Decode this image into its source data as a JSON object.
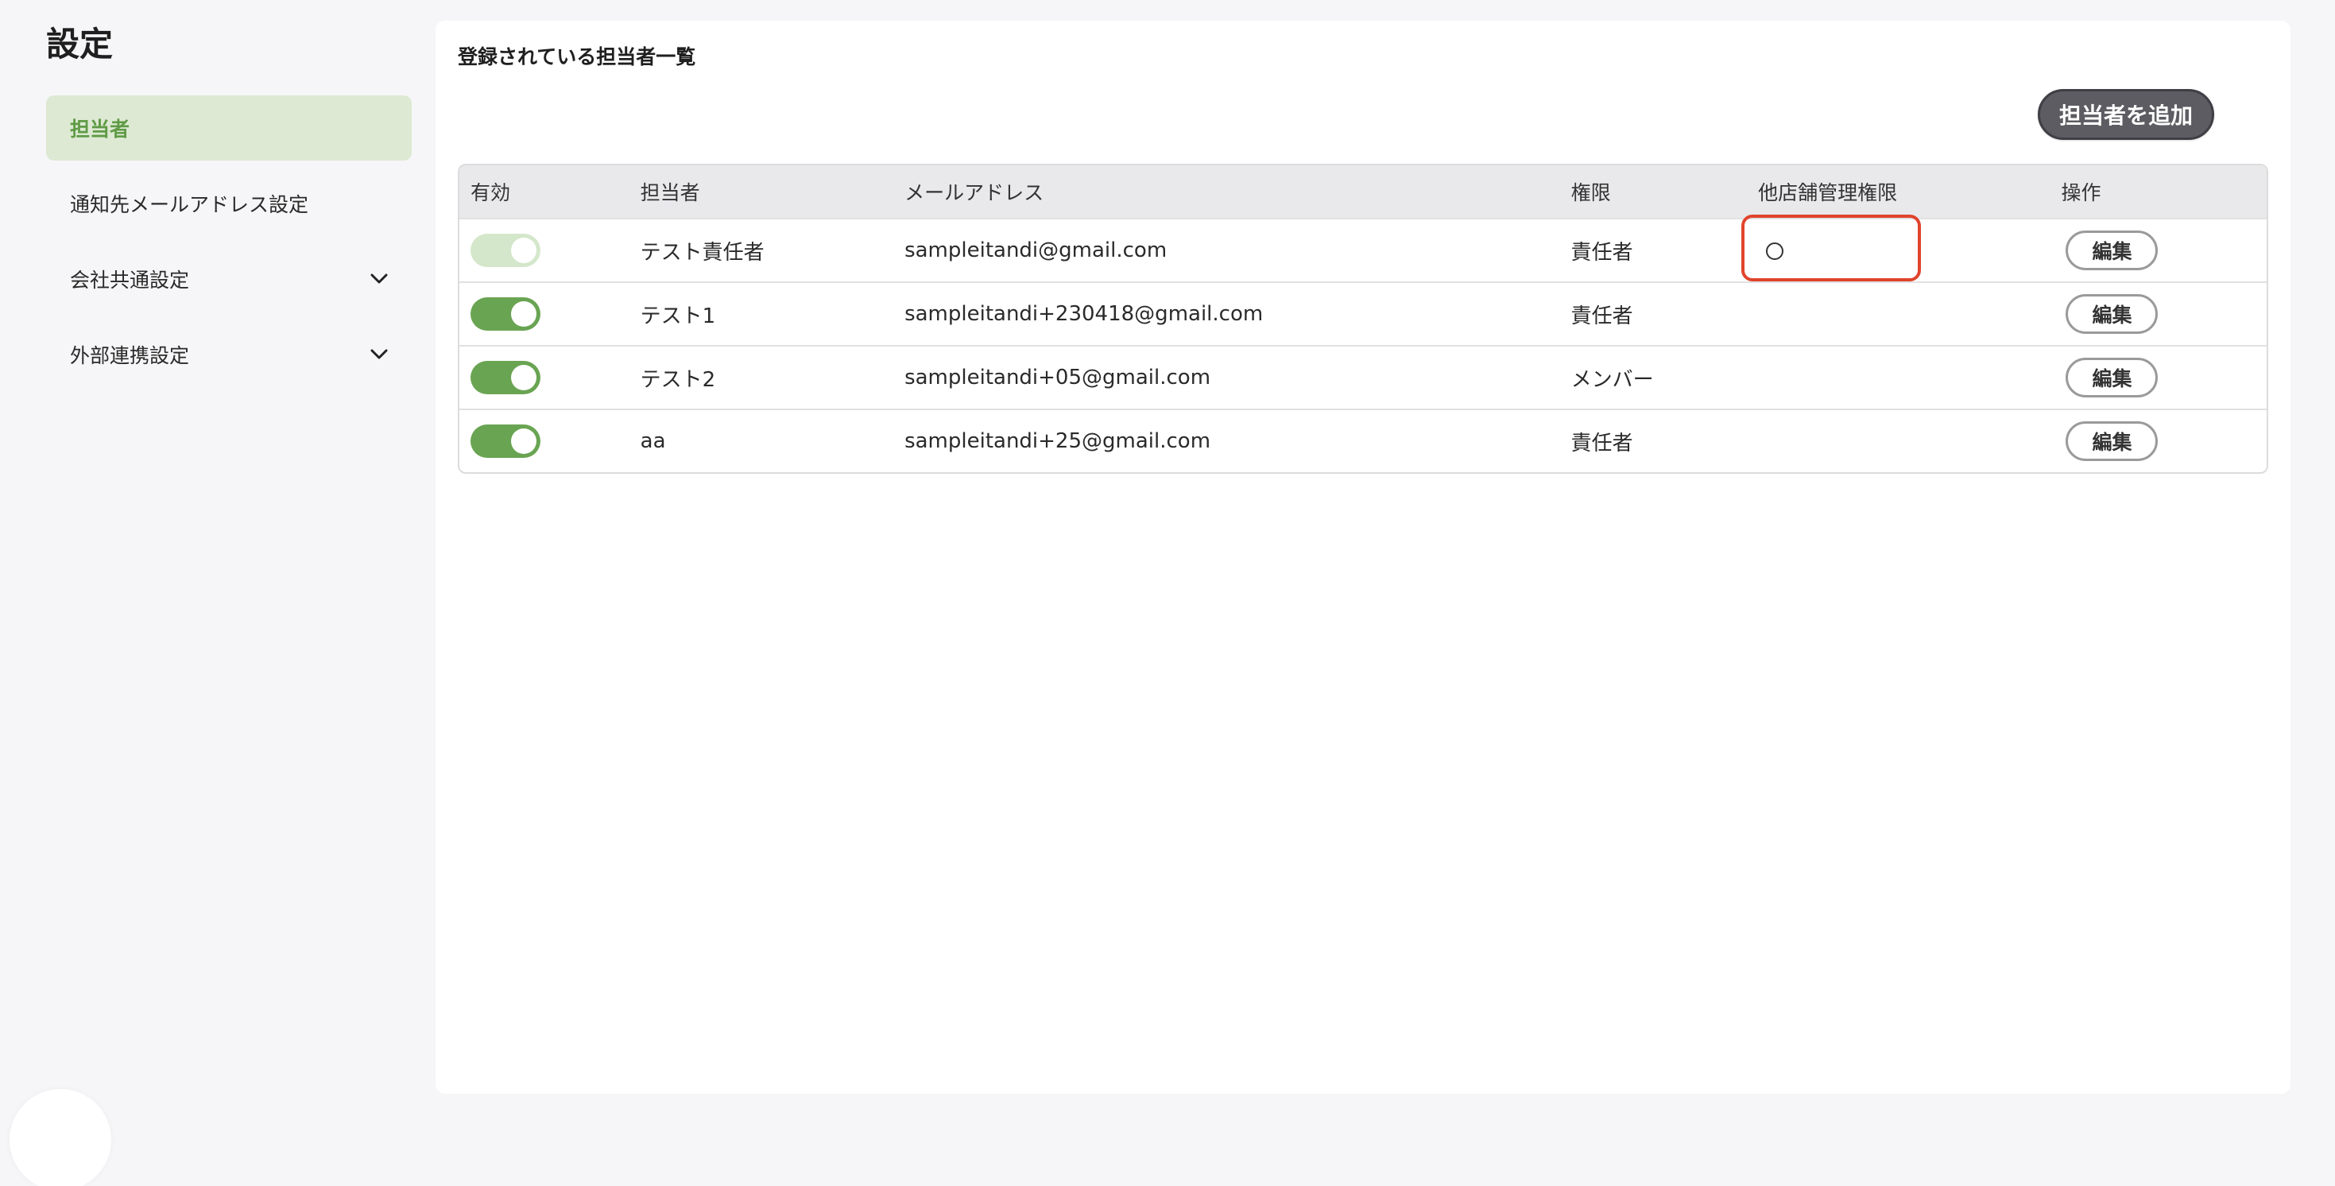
{
  "page": {
    "title": "設定"
  },
  "sidebar": {
    "items": [
      {
        "label": "担当者",
        "active": true
      },
      {
        "label": "通知先メールアドレス設定"
      },
      {
        "label": "会社共通設定",
        "has_chevron": true
      },
      {
        "label": "外部連携設定",
        "has_chevron": true
      }
    ]
  },
  "main": {
    "heading": "登録されている担当者一覧",
    "add_button": "担当者を追加",
    "table": {
      "headers": [
        "有効",
        "担当者",
        "メールアドレス",
        "権限",
        "他店舗管理権限",
        "操作"
      ],
      "rows": [
        {
          "active": true,
          "toggle_disabled": true,
          "name": "テスト責任者",
          "email": "sampleitandi@gmail.com",
          "role": "責任者",
          "other_store": "○",
          "action": "編集"
        },
        {
          "active": true,
          "toggle_disabled": false,
          "name": "テスト1",
          "email": "sampleitandi+230418@gmail.com",
          "role": "責任者",
          "other_store": "",
          "action": "編集"
        },
        {
          "active": true,
          "toggle_disabled": false,
          "name": "テスト2",
          "email": "sampleitandi+05@gmail.com",
          "role": "メンバー",
          "other_store": "",
          "action": "編集"
        },
        {
          "active": true,
          "toggle_disabled": false,
          "name": "aa",
          "email": "sampleitandi+25@gmail.com",
          "role": "責任者",
          "other_store": "",
          "action": "編集"
        }
      ]
    }
  },
  "colors": {
    "accent_green": "#69a452",
    "active_bg": "#dde9d3",
    "highlight_red": "#e0442c"
  }
}
